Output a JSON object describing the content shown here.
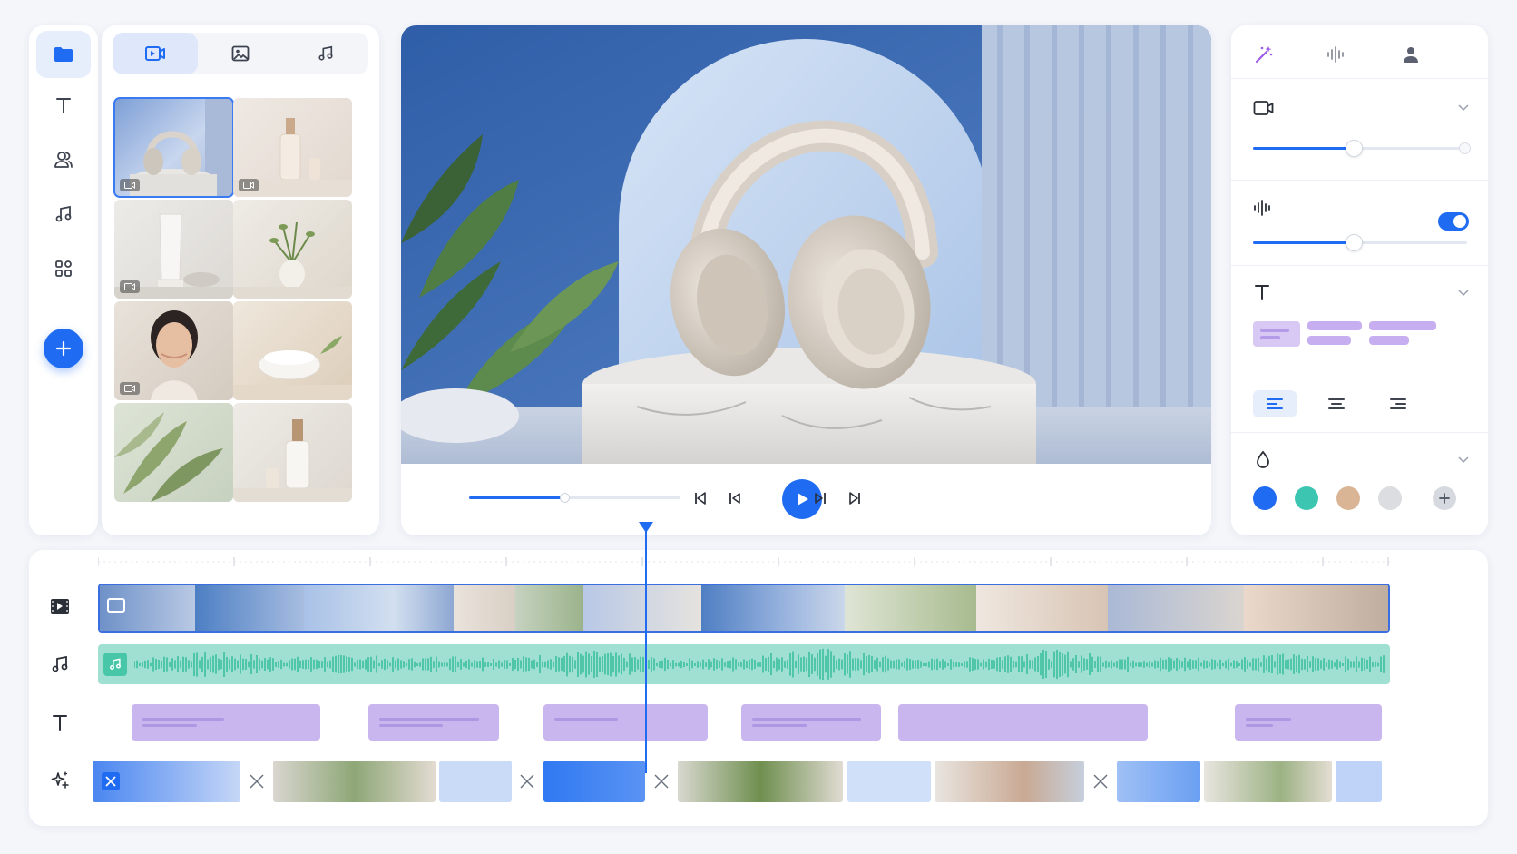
{
  "rail": {
    "items": [
      {
        "name": "media",
        "icon": "folder-icon",
        "active": true
      },
      {
        "name": "text",
        "icon": "text-icon",
        "active": false
      },
      {
        "name": "people",
        "icon": "people-icon",
        "active": false
      },
      {
        "name": "music",
        "icon": "music-note-icon",
        "active": false
      },
      {
        "name": "elements",
        "icon": "elements-grid-icon",
        "active": false
      }
    ],
    "add_icon": "plus-icon"
  },
  "library": {
    "tabs": [
      {
        "name": "videos",
        "icon": "video-camera-icon",
        "active": true
      },
      {
        "name": "images",
        "icon": "image-icon",
        "active": false
      },
      {
        "name": "audio",
        "icon": "music-note-icon",
        "active": false
      }
    ],
    "thumbnails": [
      {
        "subject": "headphones",
        "video": true,
        "selected": true
      },
      {
        "subject": "serum-bottle",
        "video": true,
        "selected": false
      },
      {
        "subject": "cream-tube",
        "video": true,
        "selected": false
      },
      {
        "subject": "plant-vase",
        "video": false,
        "selected": false
      },
      {
        "subject": "woman-portrait",
        "video": true,
        "selected": false
      },
      {
        "subject": "cream-bowl",
        "video": false,
        "selected": false
      },
      {
        "subject": "leaves",
        "video": false,
        "selected": false
      },
      {
        "subject": "dropper-bottle",
        "video": false,
        "selected": false
      }
    ]
  },
  "preview": {
    "subject": "headphones-on-marble-pedestal",
    "progress": 0.45,
    "controls": [
      "skip-start-icon",
      "step-back-icon",
      "play-icon",
      "step-forward-icon",
      "skip-end-icon"
    ]
  },
  "inspector": {
    "tabs": [
      "magic-wand-icon",
      "audio-wave-icon",
      "person-icon"
    ],
    "video": {
      "icon": "video-camera-icon",
      "level": 0.47
    },
    "audio": {
      "icon": "audio-wave-icon",
      "enabled": true,
      "level": 0.47
    },
    "text": {
      "icon": "text-icon",
      "alignments": [
        "align-left-icon",
        "align-center-icon",
        "align-right-icon"
      ],
      "selected_alignment": 0
    },
    "color": {
      "icon": "droplet-icon",
      "swatches": [
        "#1f6bf2",
        "#3cc6b2",
        "#d9b595",
        "#dcdde0"
      ],
      "add_icon": "plus-icon"
    },
    "accent": "#1f6bf2"
  },
  "timeline": {
    "playhead": 0.43,
    "tracks": [
      "video-track-icon",
      "music-note-icon",
      "text-icon",
      "sparkle-icon"
    ],
    "audio_color": "#9fe0d2",
    "text_clip_color": "#c9b6ef"
  }
}
